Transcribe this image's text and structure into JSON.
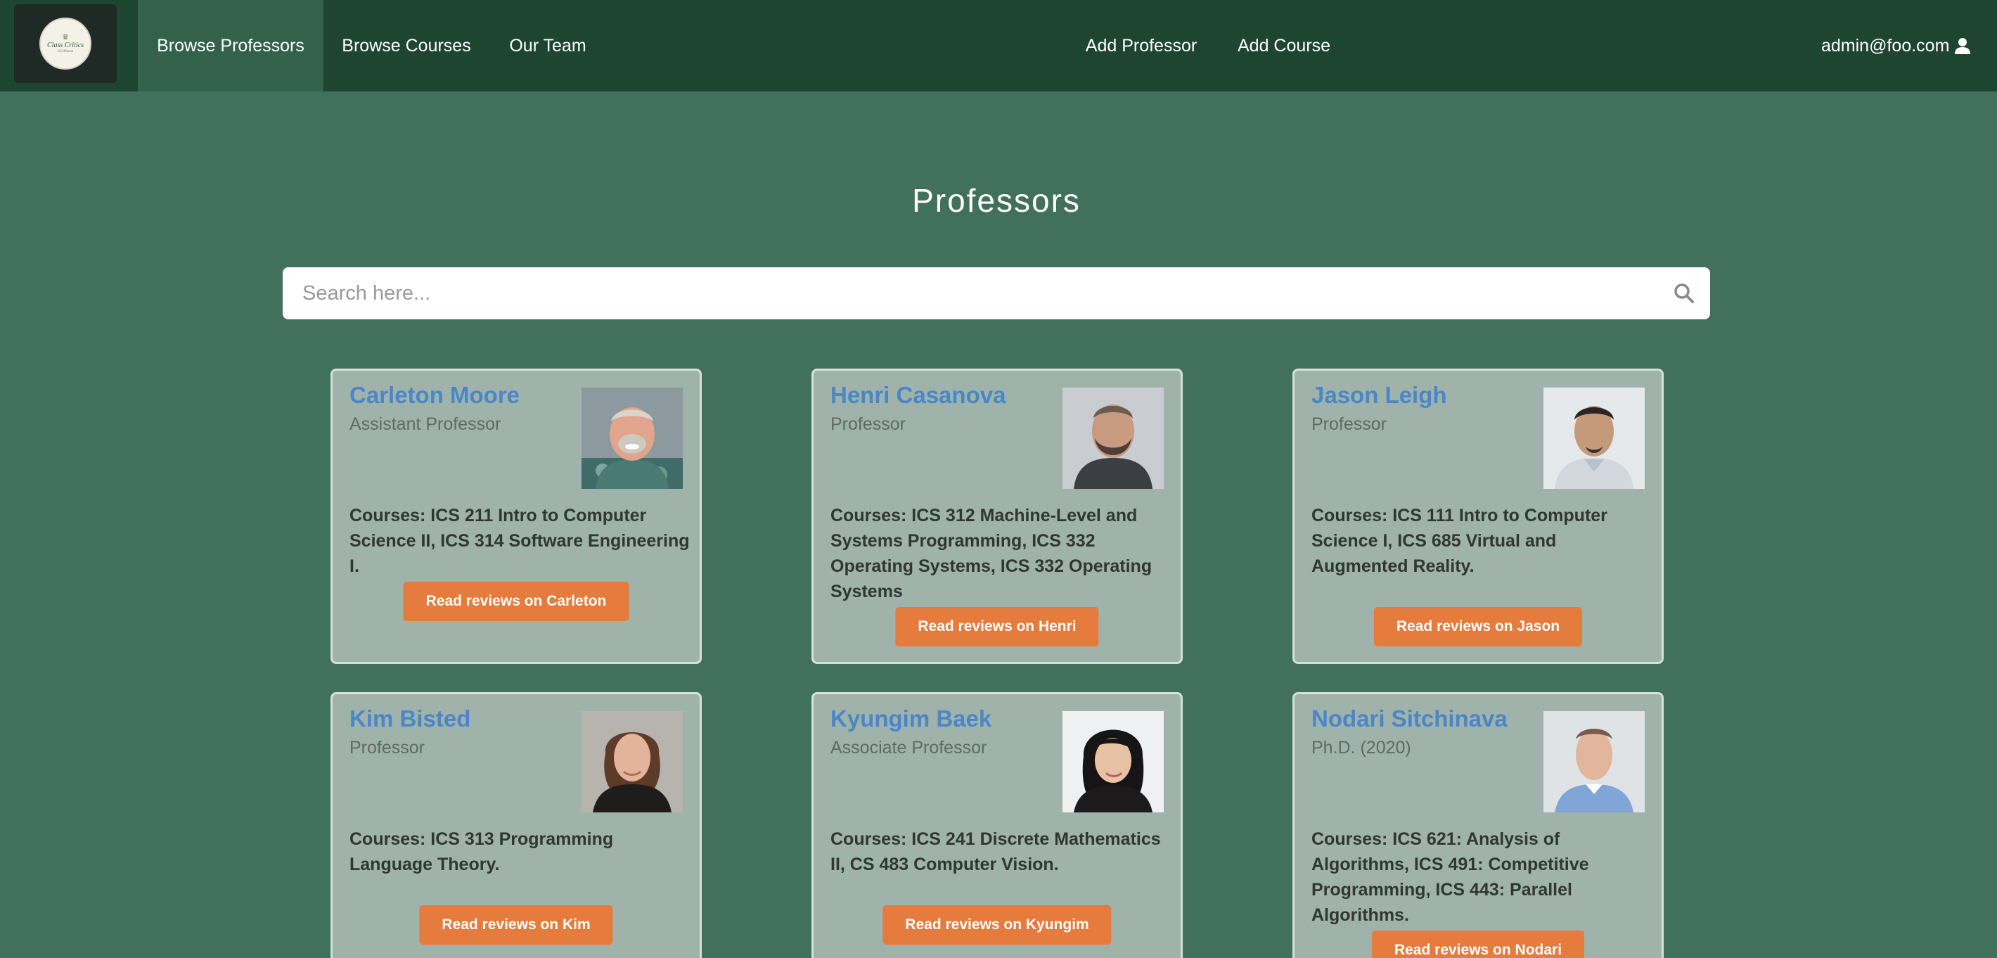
{
  "nav": {
    "logo_text": "Class Critics",
    "logo_sub": "UH Manoa",
    "browse_professors": "Browse Professors",
    "browse_courses": "Browse Courses",
    "our_team": "Our Team",
    "add_professor": "Add Professor",
    "add_course": "Add Course",
    "user": "admin@foo.com"
  },
  "page": {
    "title": "Professors",
    "search_placeholder": "Search here..."
  },
  "professors": [
    {
      "name": "Carleton Moore",
      "title": "Assistant Professor",
      "courses": "Courses: ICS 211 Intro to Computer Science II, ICS 314 Software Engineering I.",
      "button": "Read reviews on Carleton"
    },
    {
      "name": "Henri Casanova",
      "title": "Professor",
      "courses": "Courses: ICS 312 Machine-Level and Systems Programming, ICS 332 Operating Systems, ICS 332 Operating Systems",
      "button": "Read reviews on Henri"
    },
    {
      "name": "Jason Leigh",
      "title": "Professor",
      "courses": "Courses: ICS 111 Intro to Computer Science I, ICS 685 Virtual and Augmented Reality.",
      "button": "Read reviews on Jason"
    },
    {
      "name": "Kim Bisted",
      "title": "Professor",
      "courses": "Courses: ICS 313 Programming Language Theory.",
      "button": "Read reviews on Kim"
    },
    {
      "name": "Kyungim Baek",
      "title": "Associate Professor",
      "courses": "Courses: ICS 241 Discrete Mathematics II, CS 483 Computer Vision.",
      "button": "Read reviews on Kyungim"
    },
    {
      "name": "Nodari Sitchinava",
      "title": "Ph.D. (2020)",
      "courses": "Courses: ICS 621: Analysis of Algorithms, ICS 491: Competitive Programming, ICS 443: Parallel Algorithms.",
      "button": "Read reviews on Nodari"
    }
  ],
  "colors": {
    "navbar": "#1d4532",
    "page_bg": "#41705c",
    "card_bg": "#9fb3ab",
    "name_link": "#4a86c8",
    "button": "#e57b3c"
  },
  "icons": {
    "search": "search-icon",
    "user": "user-icon"
  }
}
